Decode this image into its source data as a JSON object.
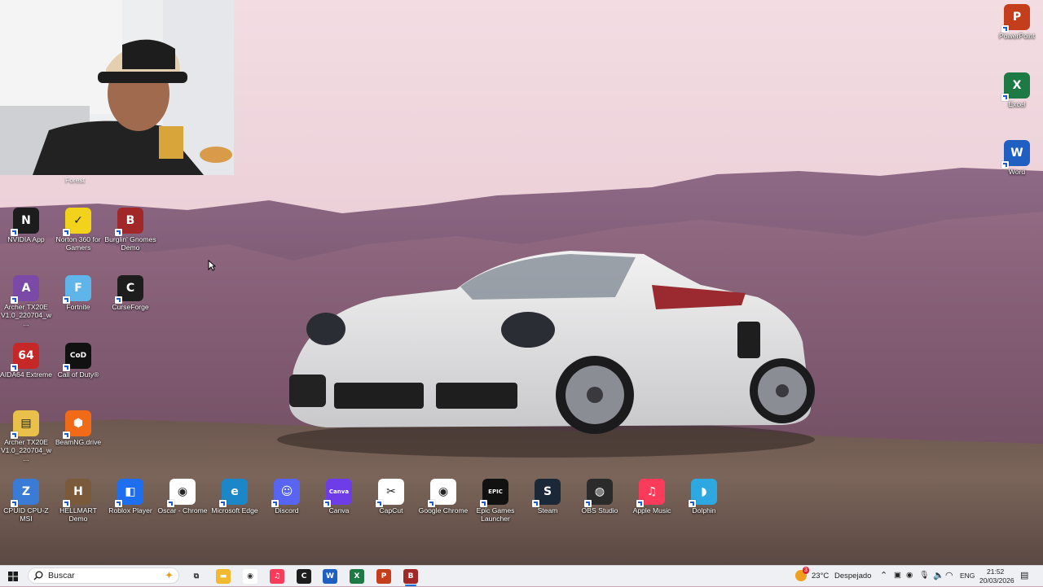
{
  "desktop": {
    "webcam_caption": "Forest",
    "icons": [
      {
        "name": "NVIDIA App",
        "color": "#1c1c1c",
        "glyph": "N"
      },
      {
        "name": "Norton 360 for Gamers",
        "color": "#f2d21a",
        "glyph": "✓"
      },
      {
        "name": "Burglin' Gnomes Demo",
        "color": "#a02828",
        "glyph": "B"
      },
      {
        "name": "Archer TX20E V1.0_220704_w...",
        "color": "#7a4aa6",
        "glyph": "A"
      },
      {
        "name": "Fortnite",
        "color": "#5fb5ea",
        "glyph": "F"
      },
      {
        "name": "CurseForge",
        "color": "#1d1d1d",
        "glyph": "C"
      },
      {
        "name": "AIDA64 Extreme",
        "color": "#c62828",
        "glyph": "64"
      },
      {
        "name": "Call of Duty®",
        "color": "#111111",
        "glyph": "CoD"
      },
      {
        "name": "Archer TX20E V1.0_220704_w...",
        "color": "#e8c04a",
        "glyph": "▤"
      },
      {
        "name": "BeamNG.drive",
        "color": "#f06a18",
        "glyph": "⬢"
      },
      {
        "name": "CPUID CPU-Z MSI",
        "color": "#3a7bd5",
        "glyph": "Z"
      },
      {
        "name": "HELLMART Demo",
        "color": "#7a5a3a",
        "glyph": "H"
      },
      {
        "name": "Roblox Player",
        "color": "#1e6ff0",
        "glyph": "◧"
      },
      {
        "name": "Oscar - Chrome",
        "color": "#ffffff",
        "glyph": "◉"
      },
      {
        "name": "Microsoft Edge",
        "color": "#1b86c8",
        "glyph": "e"
      },
      {
        "name": "Discord",
        "color": "#5865f2",
        "glyph": "☺"
      },
      {
        "name": "Canva",
        "color": "#6f3de8",
        "glyph": "Canva"
      },
      {
        "name": "CapCut",
        "color": "#ffffff",
        "glyph": "✂"
      },
      {
        "name": "Google Chrome",
        "color": "#ffffff",
        "glyph": "◉"
      },
      {
        "name": "Epic Games Launcher",
        "color": "#111111",
        "glyph": "EPIC"
      },
      {
        "name": "Steam",
        "color": "#1b2838",
        "glyph": "S"
      },
      {
        "name": "OBS Studio",
        "color": "#2b2b2b",
        "glyph": "◍"
      },
      {
        "name": "Apple Music",
        "color": "#fa3b5a",
        "glyph": "♫"
      },
      {
        "name": "Dolphin",
        "color": "#2ea8e0",
        "glyph": "◗"
      },
      {
        "name": "PowerPoint",
        "color": "#c43e1c",
        "glyph": "P"
      },
      {
        "name": "Excel",
        "color": "#1d7a45",
        "glyph": "X"
      },
      {
        "name": "Word",
        "color": "#1f5fc1",
        "glyph": "W"
      }
    ]
  },
  "taskbar": {
    "search_placeholder": "Buscar",
    "pinned": [
      {
        "name": "task-view",
        "color": "#eef0f4",
        "glyph": "⧉"
      },
      {
        "name": "file-explorer",
        "color": "#f2b92e",
        "glyph": "▬"
      },
      {
        "name": "chrome",
        "color": "#ffffff",
        "glyph": "◉"
      },
      {
        "name": "apple-music",
        "color": "#fa3b5a",
        "glyph": "♫"
      },
      {
        "name": "curseforge",
        "color": "#1d1d1d",
        "glyph": "C"
      },
      {
        "name": "word",
        "color": "#1f5fc1",
        "glyph": "W"
      },
      {
        "name": "excel",
        "color": "#1d7a45",
        "glyph": "X"
      },
      {
        "name": "powerpoint",
        "color": "#c43e1c",
        "glyph": "P"
      },
      {
        "name": "burglin-gnomes",
        "color": "#a02828",
        "glyph": "B"
      }
    ],
    "weather": {
      "temp": "23°C",
      "condition": "Despejado",
      "badge": "3"
    },
    "language": "ENG",
    "time": "21:52",
    "date": "20/03/2026"
  }
}
